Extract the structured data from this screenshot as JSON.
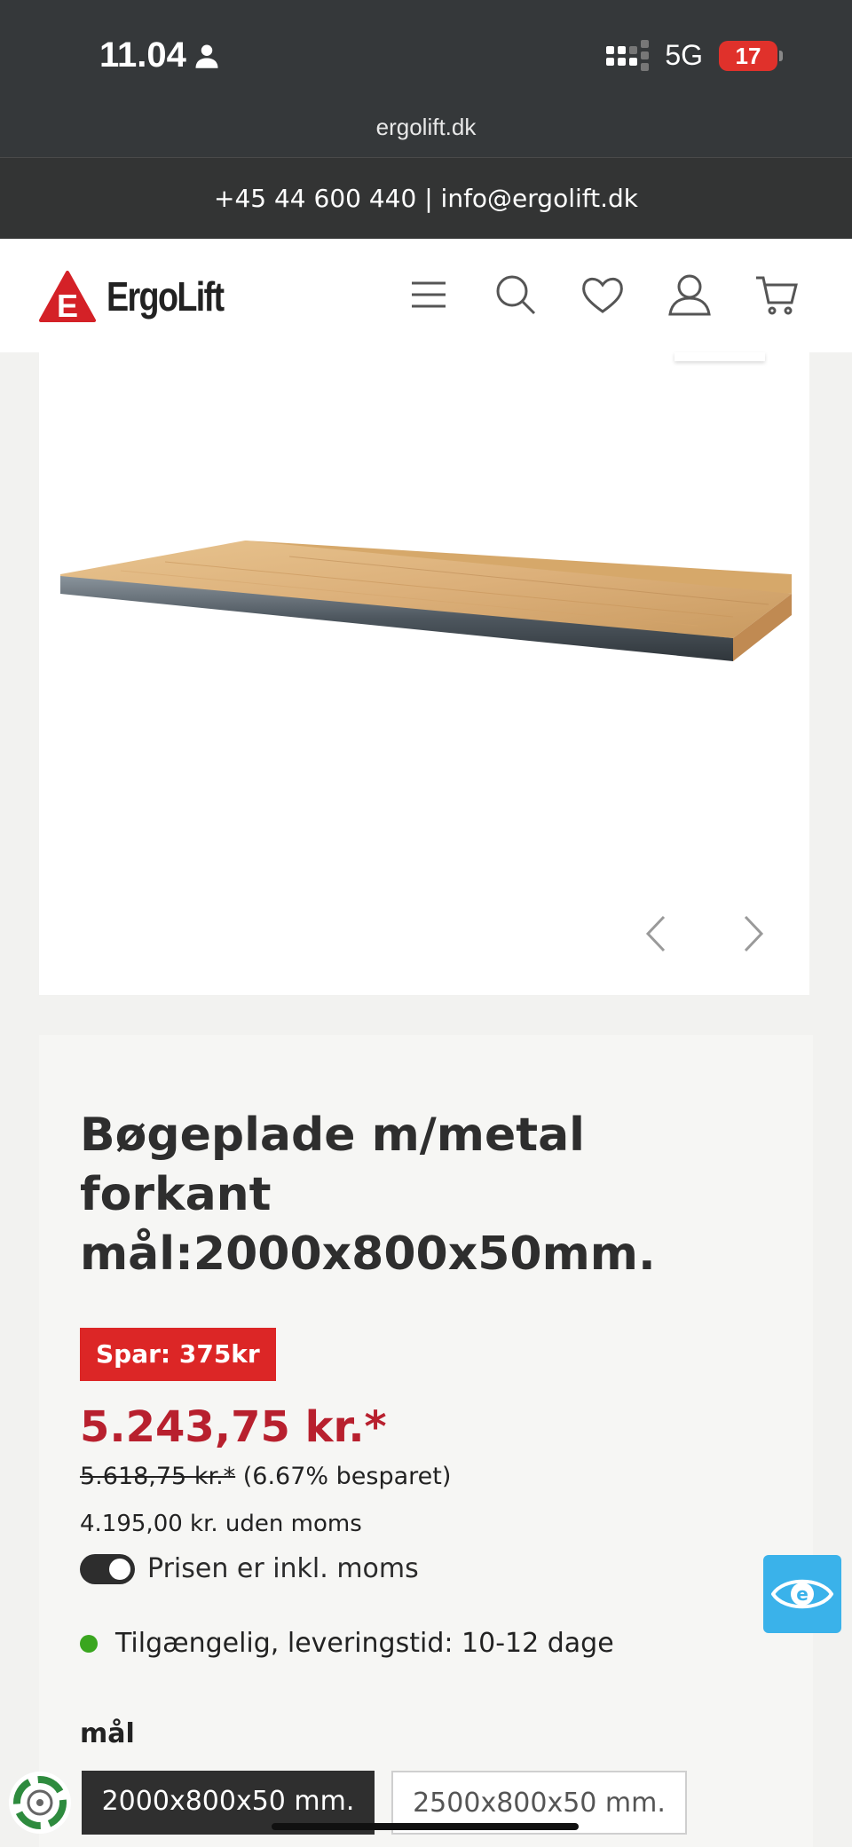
{
  "status_bar": {
    "time": "11.04",
    "network": "5G",
    "battery": "17",
    "url": "ergolift.dk"
  },
  "contact_bar": {
    "text": "+45 44 600 440 | info@ergolift.dk"
  },
  "header": {
    "logo_letter": "E",
    "logo_text": "ErgoLift",
    "icons": [
      "menu-icon",
      "search-icon",
      "heart-icon",
      "user-icon",
      "cart-icon"
    ]
  },
  "product": {
    "title": "Bøgeplade m/metal forkant mål:2000x800x50mm.",
    "save_badge": "Spar: 375kr",
    "price": "5.243,75 kr.*",
    "old_price": "5.618,75 kr.*",
    "saved_percent": "(6.67% besparet)",
    "price_ex_vat": "4.195,00 kr. uden moms",
    "vat_toggle_label": "Prisen er inkl. moms",
    "availability": "Tilgængelig, leveringstid: 10-12 dage",
    "dimension_label": "mål",
    "sizes": [
      "2000x800x50 mm.",
      "2500x800x50 mm."
    ]
  },
  "colors": {
    "price_red": "#b8202e",
    "badge_red": "#dc2626",
    "status_green": "#3aa61f",
    "accessibility_blue": "#3ab2ea"
  }
}
